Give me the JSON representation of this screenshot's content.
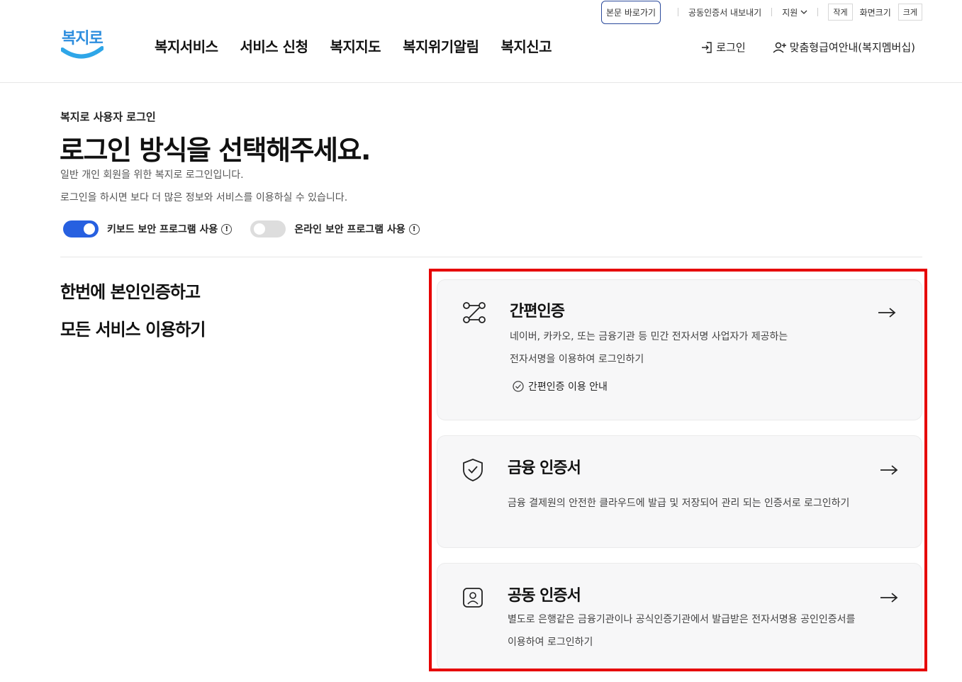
{
  "utility": {
    "skip": "본문 바로가기",
    "cert_export": "공동인증서 내보내기",
    "support": "지원",
    "small": "작게",
    "screen_size": "화면크기",
    "large": "크게"
  },
  "header": {
    "logo": "복지로",
    "nav": [
      "복지서비스",
      "서비스 신청",
      "복지지도",
      "복지위기알림",
      "복지신고"
    ],
    "login": "로그인",
    "membership": "맞춤형급여안내(복지멤버십)"
  },
  "main": {
    "subtitle": "복지로 사용자 로그인",
    "title": "로그인 방식을 선택해주세요.",
    "desc1": "일반 개인 회원을 위한 복지로 로그인입니다.",
    "desc2": "로그인을 하시면 보다 더 많은 정보와 서비스를 이용하실 수 있습니다.",
    "toggle_keyboard": "키보드 보안 프로그램 사용",
    "toggle_online": "온라인 보안 프로그램 사용",
    "lead1": "한번에 본인인증하고",
    "lead2": "모든 서비스 이용하기"
  },
  "cards": [
    {
      "title": "간편인증",
      "desc1": "네이버, 카카오, 또는 금융기관 등 민간 전자서명 사업자가 제공하는",
      "desc2": "전자서명을 이용하여 로그인하기",
      "guide": "간편인증 이용 안내"
    },
    {
      "title": "금융 인증서",
      "desc1": "금융 결제원의 안전한 클라우드에 발급 및 저장되어 관리 되는 인증서로 로그인하기"
    },
    {
      "title": "공동 인증서",
      "desc1": "별도로 은행같은 금융기관이나 공식인증기관에서 발급받은 전자서명용 공인인증서를",
      "desc2": "이용하여 로그인하기"
    }
  ],
  "colors": {
    "accent": "#2760e0",
    "highlight": "#e60000",
    "logo": "#2e8ede"
  },
  "toggles": {
    "keyboard_on": true,
    "online_on": false
  }
}
